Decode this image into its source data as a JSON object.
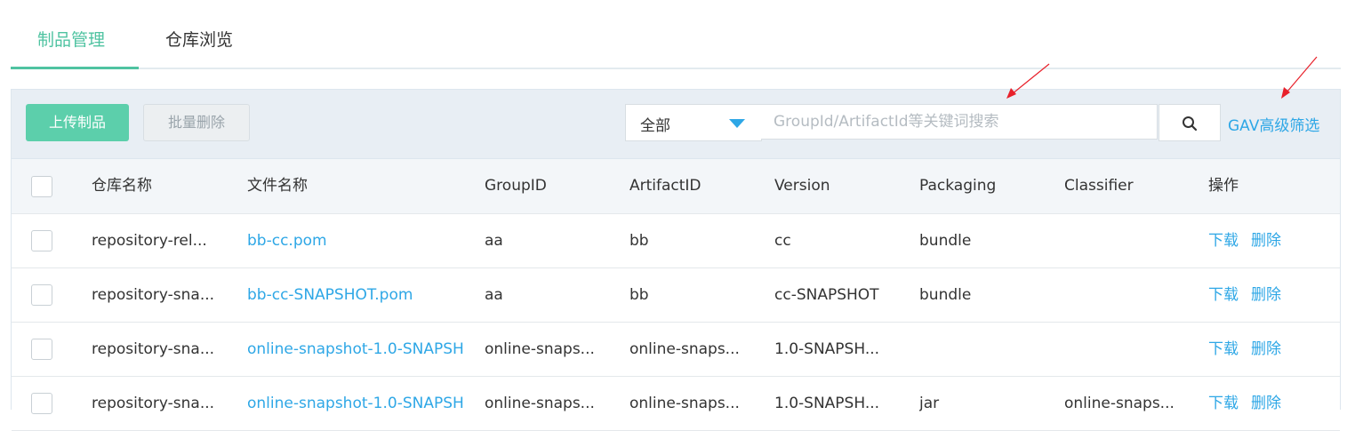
{
  "tabs": [
    {
      "label": "制品管理",
      "active": true
    },
    {
      "label": "仓库浏览",
      "active": false
    }
  ],
  "toolbar": {
    "upload_label": "上传制品",
    "batch_delete_label": "批量删除",
    "scope_select": {
      "selected": "全部"
    },
    "search": {
      "placeholder": "GroupId/ArtifactId等关键词搜索",
      "value": ""
    },
    "gav_filter_label": "GAV高级筛选"
  },
  "table": {
    "columns": [
      "仓库名称",
      "文件名称",
      "GroupID",
      "ArtifactID",
      "Version",
      "Packaging",
      "Classifier",
      "操作"
    ],
    "rows": [
      {
        "repo": "repository-rel...",
        "file": "bb-cc.pom",
        "group": "aa",
        "artifact": "bb",
        "version": "cc",
        "packaging": "bundle",
        "classifier": ""
      },
      {
        "repo": "repository-sna...",
        "file": "bb-cc-SNAPSHOT.pom",
        "group": "aa",
        "artifact": "bb",
        "version": "cc-SNAPSHOT",
        "packaging": "bundle",
        "classifier": ""
      },
      {
        "repo": "repository-sna...",
        "file": "online-snapshot-1.0-SNAPSH",
        "group": "online-snaps...",
        "artifact": "online-snaps...",
        "version": "1.0-SNAPSH...",
        "packaging": "",
        "classifier": ""
      },
      {
        "repo": "repository-sna...",
        "file": "online-snapshot-1.0-SNAPSH",
        "group": "online-snaps...",
        "artifact": "online-snaps...",
        "version": "1.0-SNAPSH...",
        "packaging": "jar",
        "classifier": "online-snaps..."
      }
    ],
    "actions": {
      "download": "下载",
      "delete": "删除"
    }
  },
  "colors": {
    "accent_green": "#4fc3a1",
    "link_blue": "#2ea7e6",
    "annotation_red": "#e8202a"
  },
  "icons": {
    "search_button": "search-icon",
    "select_caret": "caret-down-icon"
  }
}
